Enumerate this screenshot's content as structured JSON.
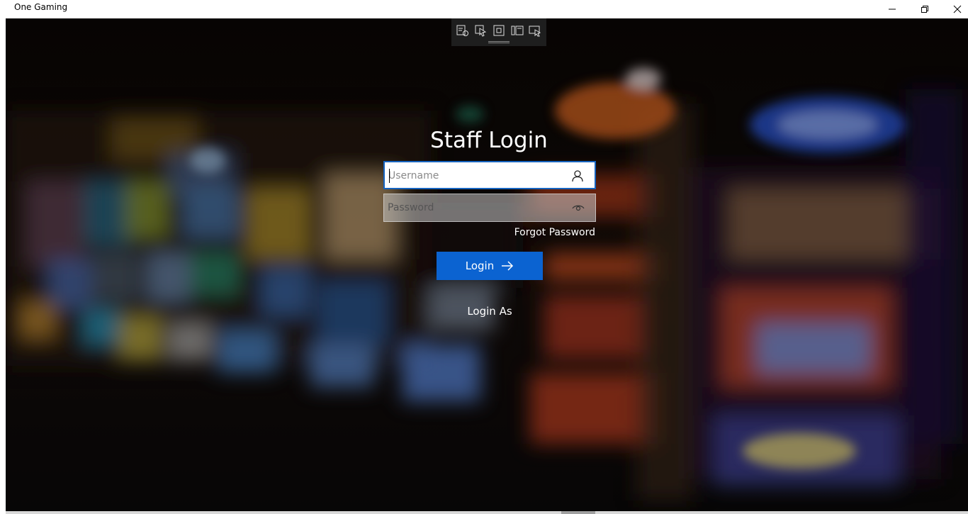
{
  "window": {
    "title": "One Gaming",
    "minimize_icon": "minimize-icon",
    "maximize_icon": "restore-icon",
    "close_icon": "close-icon"
  },
  "devtools": {
    "icons": [
      "live-visual-tree-icon",
      "select-element-icon",
      "display-layout-adorners-icon",
      "track-focus-icon",
      "hot-reload-icon"
    ]
  },
  "login": {
    "title": "Staff Login",
    "username": {
      "value": "",
      "placeholder": "Username",
      "icon": "user-icon"
    },
    "password": {
      "value": "",
      "placeholder": "Password",
      "icon": "reveal-password-eye-icon"
    },
    "forgot_label": "Forgot Password",
    "login_label": "Login",
    "login_icon": "arrow-right-icon",
    "login_as_label": "Login As"
  },
  "colors": {
    "accent": "#0b63d1",
    "focus_border": "#1664c0",
    "background": "#0b0807"
  }
}
